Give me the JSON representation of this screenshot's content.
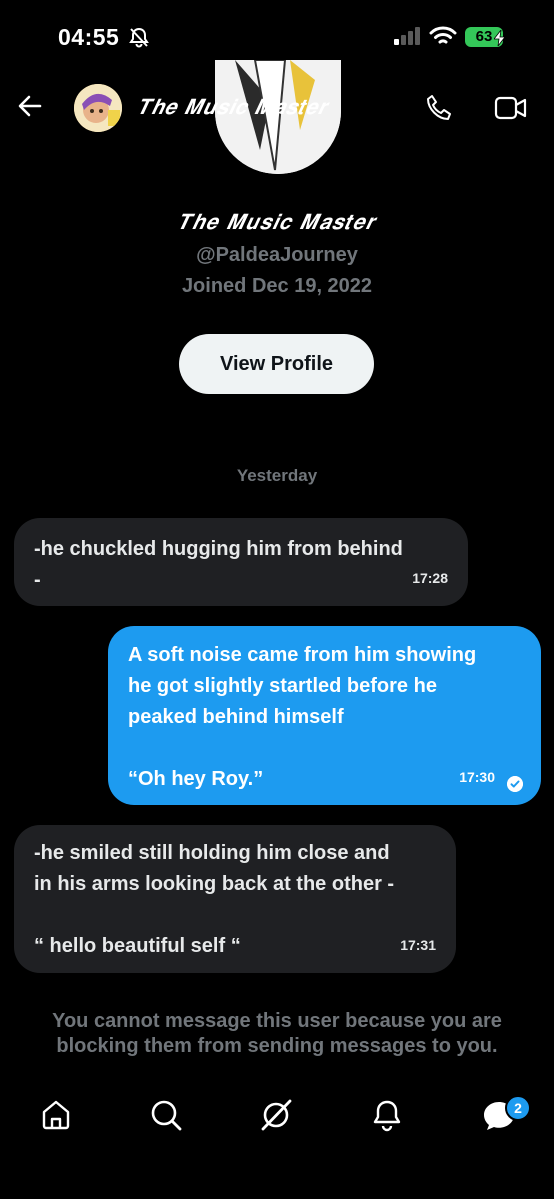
{
  "status_bar": {
    "time": "04:55",
    "battery": "63"
  },
  "header": {
    "title": "𝑻𝒉𝒆 𝑴𝒖𝒔𝒊𝒄 𝑴𝒂𝒔𝒕𝒆𝒓",
    "back_icon": "arrow-left-icon",
    "call_icon": "phone-icon",
    "video_icon": "video-icon"
  },
  "profile": {
    "name": "𝑻𝒉𝒆 𝑴𝒖𝒔𝒊𝒄 𝑴𝒂𝒔𝒕𝒆𝒓",
    "handle": "@PaldeaJourney",
    "joined": "Joined Dec 19, 2022",
    "view_profile_label": "View Profile"
  },
  "conversation": {
    "day_label": "Yesterday",
    "messages": [
      {
        "direction": "incoming",
        "lines": [
          "-he chuckled hugging him from behind",
          "-"
        ],
        "time": "17:28"
      },
      {
        "direction": "outgoing",
        "lines": [
          "A soft noise came from him showing",
          "he got slightly startled before he",
          "peaked behind himself",
          "",
          "“Oh hey Roy.”"
        ],
        "time": "17:30",
        "read": true
      },
      {
        "direction": "incoming",
        "lines": [
          "-he smiled still holding him close and",
          "in his arms looking back at the other -",
          "",
          "“ hello beautiful self “"
        ],
        "time": "17:31"
      }
    ]
  },
  "blocked_notice": "You cannot message this user because you are blocking them from sending messages to you.",
  "bottom_nav": {
    "items": [
      "home-icon",
      "search-icon",
      "grok-icon",
      "notifications-icon",
      "messages-icon"
    ],
    "messages_badge": "2"
  },
  "colors": {
    "accent": "#1d9bf0",
    "incoming_bubble": "#1f2023",
    "muted_text": "#71767b",
    "battery": "#34c759"
  }
}
